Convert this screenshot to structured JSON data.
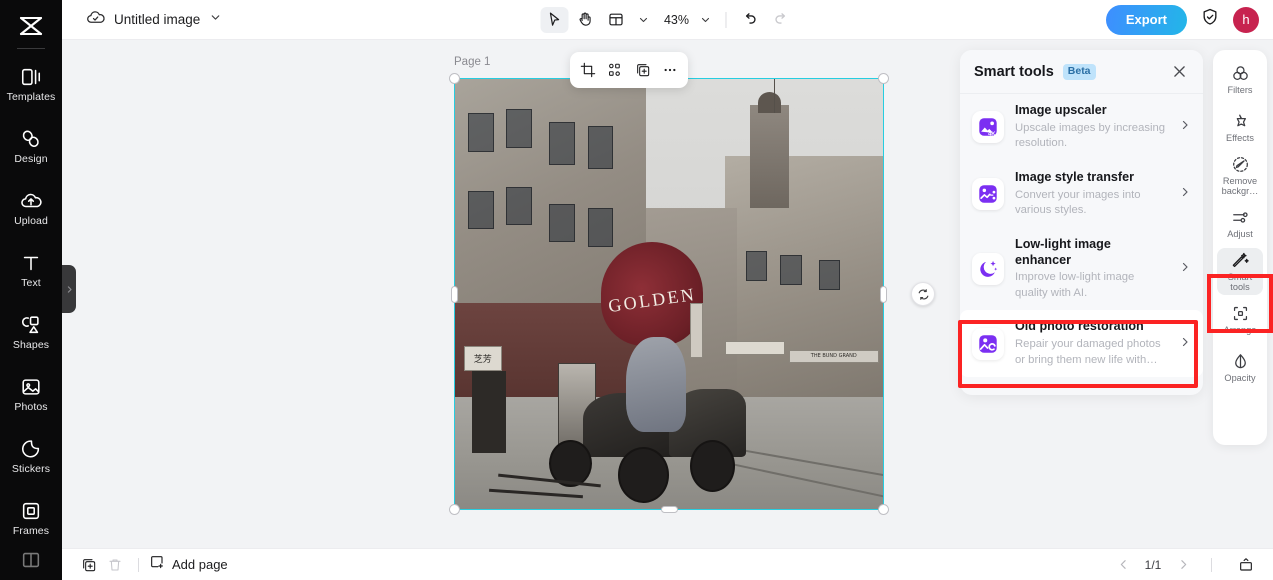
{
  "app": {
    "logo_icon": "capcut-logo-icon"
  },
  "sidebar": {
    "items": [
      {
        "label": "Templates",
        "icon": "templates-icon"
      },
      {
        "label": "Design",
        "icon": "design-icon"
      },
      {
        "label": "Upload",
        "icon": "upload-cloud-icon"
      },
      {
        "label": "Text",
        "icon": "text-icon"
      },
      {
        "label": "Shapes",
        "icon": "shapes-icon"
      },
      {
        "label": "Photos",
        "icon": "photos-icon"
      },
      {
        "label": "Stickers",
        "icon": "stickers-icon"
      },
      {
        "label": "Frames",
        "icon": "frames-icon"
      }
    ],
    "collapse_icon": "chevron-right-icon"
  },
  "topbar": {
    "cloud_icon": "cloud-saved-icon",
    "doc_title": "Untitled image",
    "title_chevron_icon": "chevron-down-icon",
    "select_tool_icon": "cursor-select-icon",
    "hand_tool_icon": "hand-pan-icon",
    "layout_tool_icon": "layout-grid-icon",
    "layout_chevron_icon": "chevron-down-icon",
    "zoom_value": "43%",
    "zoom_chevron_icon": "chevron-down-icon",
    "undo_icon": "undo-arrow-icon",
    "redo_icon": "redo-arrow-icon",
    "export_label": "Export",
    "shield_icon": "shield-check-icon",
    "avatar_initial": "h"
  },
  "canvas": {
    "page_label": "Page 1",
    "object_toolbar": [
      {
        "icon": "crop-icon",
        "name": "crop-button"
      },
      {
        "icon": "flip-icon",
        "name": "flip-button"
      },
      {
        "icon": "duplicate-icon",
        "name": "duplicate-button"
      },
      {
        "icon": "more-icon",
        "name": "more-options-button"
      }
    ],
    "rotate_icon": "rotate-icon",
    "image_sign_text": "GOLDEN",
    "image_sign_text_cn": "芝芳",
    "image_banner_text": "THE BUND GRAND"
  },
  "smart_panel": {
    "title": "Smart tools",
    "badge": "Beta",
    "close_icon": "close-icon",
    "tools": [
      {
        "name": "Image upscaler",
        "desc": "Upscale images by increasing resolution.",
        "icon": "upscaler-4k-icon",
        "arrow_icon": "chevron-right-icon",
        "selected": false
      },
      {
        "name": "Image style transfer",
        "desc": "Convert your images into various styles.",
        "icon": "style-transfer-icon",
        "arrow_icon": "chevron-right-icon",
        "selected": false
      },
      {
        "name": "Low-light image enhancer",
        "desc": "Improve low-light image quality with AI.",
        "icon": "moon-stars-icon",
        "arrow_icon": "chevron-right-icon",
        "selected": false
      },
      {
        "name": "Old photo restoration",
        "desc": "Repair your damaged photos or bring them new life with…",
        "icon": "photo-restore-icon",
        "arrow_icon": "chevron-right-icon",
        "selected": true
      }
    ]
  },
  "right_rail": {
    "items": [
      {
        "label": "Filters",
        "icon": "filters-icon",
        "active": false
      },
      {
        "label": "Effects",
        "icon": "effects-icon",
        "active": false
      },
      {
        "label": "Remove backgr…",
        "icon": "remove-bg-icon",
        "active": false
      },
      {
        "label": "Adjust",
        "icon": "adjust-sliders-icon",
        "active": false
      },
      {
        "label": "Smart tools",
        "icon": "magic-wand-icon",
        "active": true
      },
      {
        "label": "Arrange",
        "icon": "arrange-icon",
        "active": false
      },
      {
        "label": "Opacity",
        "icon": "opacity-drop-icon",
        "active": false
      }
    ]
  },
  "bottombar": {
    "duplicate_page_icon": "duplicate-page-icon",
    "delete_page_icon": "trash-icon",
    "add_page_icon": "add-page-icon",
    "add_page_label": "Add page",
    "prev_icon": "chevron-left-icon",
    "page_count": "1/1",
    "next_icon": "chevron-right-icon",
    "present_icon": "present-icon"
  },
  "colors": {
    "accent_export_from": "#3e8eff",
    "accent_export_to": "#23b6e8",
    "selection_cyan": "#27cde0",
    "highlight_red": "#fb2323",
    "tool_purple": "#7b2ff2",
    "badge_blue_bg": "#bfe3fb",
    "avatar_pink": "#c7234f",
    "canvas_bg": "#f2f3f5",
    "rail_black": "#0a0a0b"
  }
}
